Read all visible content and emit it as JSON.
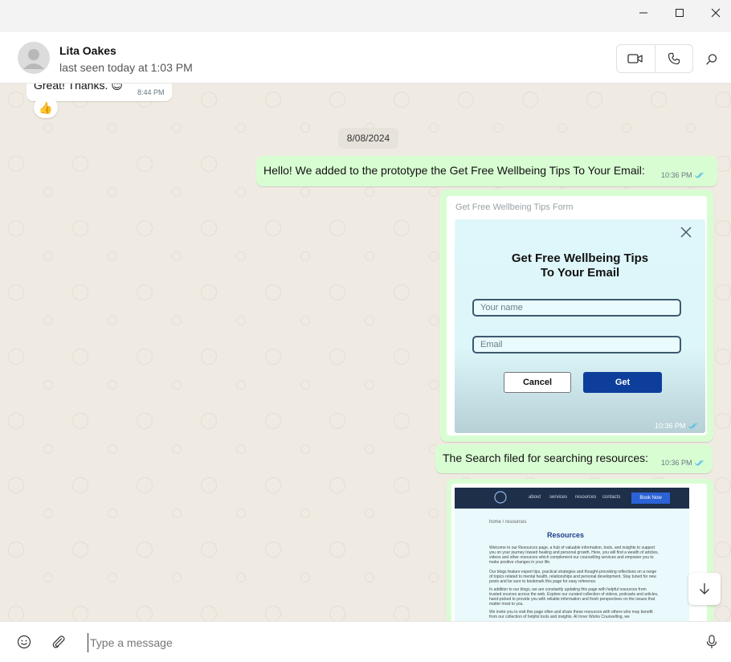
{
  "window": {
    "minimize_glyph": "—",
    "maximize_glyph": "☐",
    "close_glyph": "✕"
  },
  "header": {
    "contact_name": "Lita Oakes",
    "status": "last seen today at 1:03 PM",
    "icons": [
      "video-call-icon",
      "voice-call-icon",
      "search-icon"
    ]
  },
  "messages": {
    "prev": {
      "text": "Great! Thanks. 😊",
      "time": "8:44 PM",
      "reaction": "👍"
    },
    "date_chip": "8/08/2024",
    "m1": {
      "text": "Hello! We added to the prototype the Get Free Wellbeing Tips To Your Email:",
      "time": "10:36 PM"
    },
    "m2": {
      "caption": "Get Free Wellbeing Tips Form",
      "time": "10:36 PM",
      "form": {
        "title_line1": "Get Free Wellbeing Tips",
        "title_line2": "To Your Email",
        "name_placeholder": "Your name",
        "email_placeholder": "Email",
        "cancel_label": "Cancel",
        "get_label": "Get"
      }
    },
    "m3": {
      "text": "The Search filed for searching resources:",
      "time": "10:36 PM"
    },
    "m4": {
      "site": {
        "nav": [
          "about",
          "services",
          "resources",
          "contacts"
        ],
        "book_label": "Book Now",
        "crumb": "home / resources",
        "heading": "Resources",
        "p1": "Welcome to our Resources page, a hub of valuable information, tools, and insights to support you on your journey toward healing and personal growth. Here, you will find a wealth of articles, videos and other resources which complement our counselling services and empower you to make positive changes in your life.",
        "p2": "Our blogs feature expert tips, practical strategies and thought-provoking reflections on a range of topics related to mental health, relationships and personal development. Stay tuned for new posts and be sure to bookmark this page for easy reference.",
        "p3": "In addition to our blogs, we are constantly updating this page with helpful resources from trusted sources across the web. Explore our curated collection of videos, podcasts and articles, hand-picked to provide you with reliable information and fresh perspectives on the issues that matter most to you.",
        "p4": "We invite you to visit this page often and share these resources with others who may benefit from our collection of helpful tools and insights. At Inner Works Counselling, we"
      }
    }
  },
  "composer": {
    "placeholder": "Type a message"
  },
  "colors": {
    "incoming": "#ffffff",
    "outgoing": "#d9fdd3",
    "chat_bg": "#efeae2",
    "tick": "#53bdeb",
    "get_button": "#0d3e9c"
  }
}
